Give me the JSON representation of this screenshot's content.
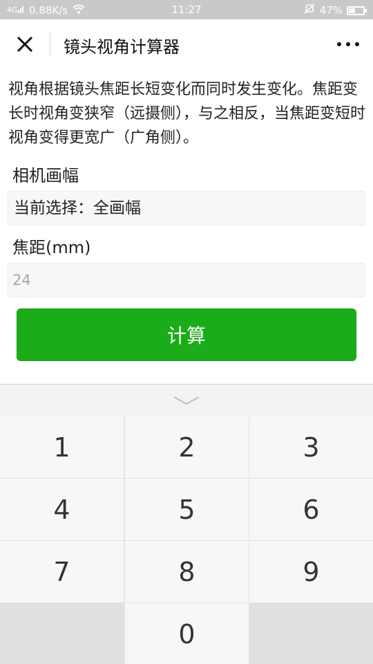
{
  "status_bar": {
    "signal_text": "0.88K/s",
    "time": "11:27",
    "battery_percent": "47%",
    "battery_level": 0.47
  },
  "navbar": {
    "title": "镜头视角计算器"
  },
  "description": "视角根据镜头焦距长短变化而同时发生变化。焦距变长时视角变狭窄（远摄侧），与之相反，当焦距变短时视角变得更宽广（广角侧）。",
  "form": {
    "camera_label": "相机画幅",
    "camera_value": "当前选择：全画幅",
    "focal_label": "焦距(mm)",
    "focal_placeholder": "24",
    "calc_label": "计算"
  },
  "keyboard": {
    "keys": [
      "1",
      "2",
      "3",
      "4",
      "5",
      "6",
      "7",
      "8",
      "9",
      "",
      "0",
      ""
    ]
  },
  "colors": {
    "accent": "#1aad19",
    "status_bar": "#c9c9c9"
  }
}
